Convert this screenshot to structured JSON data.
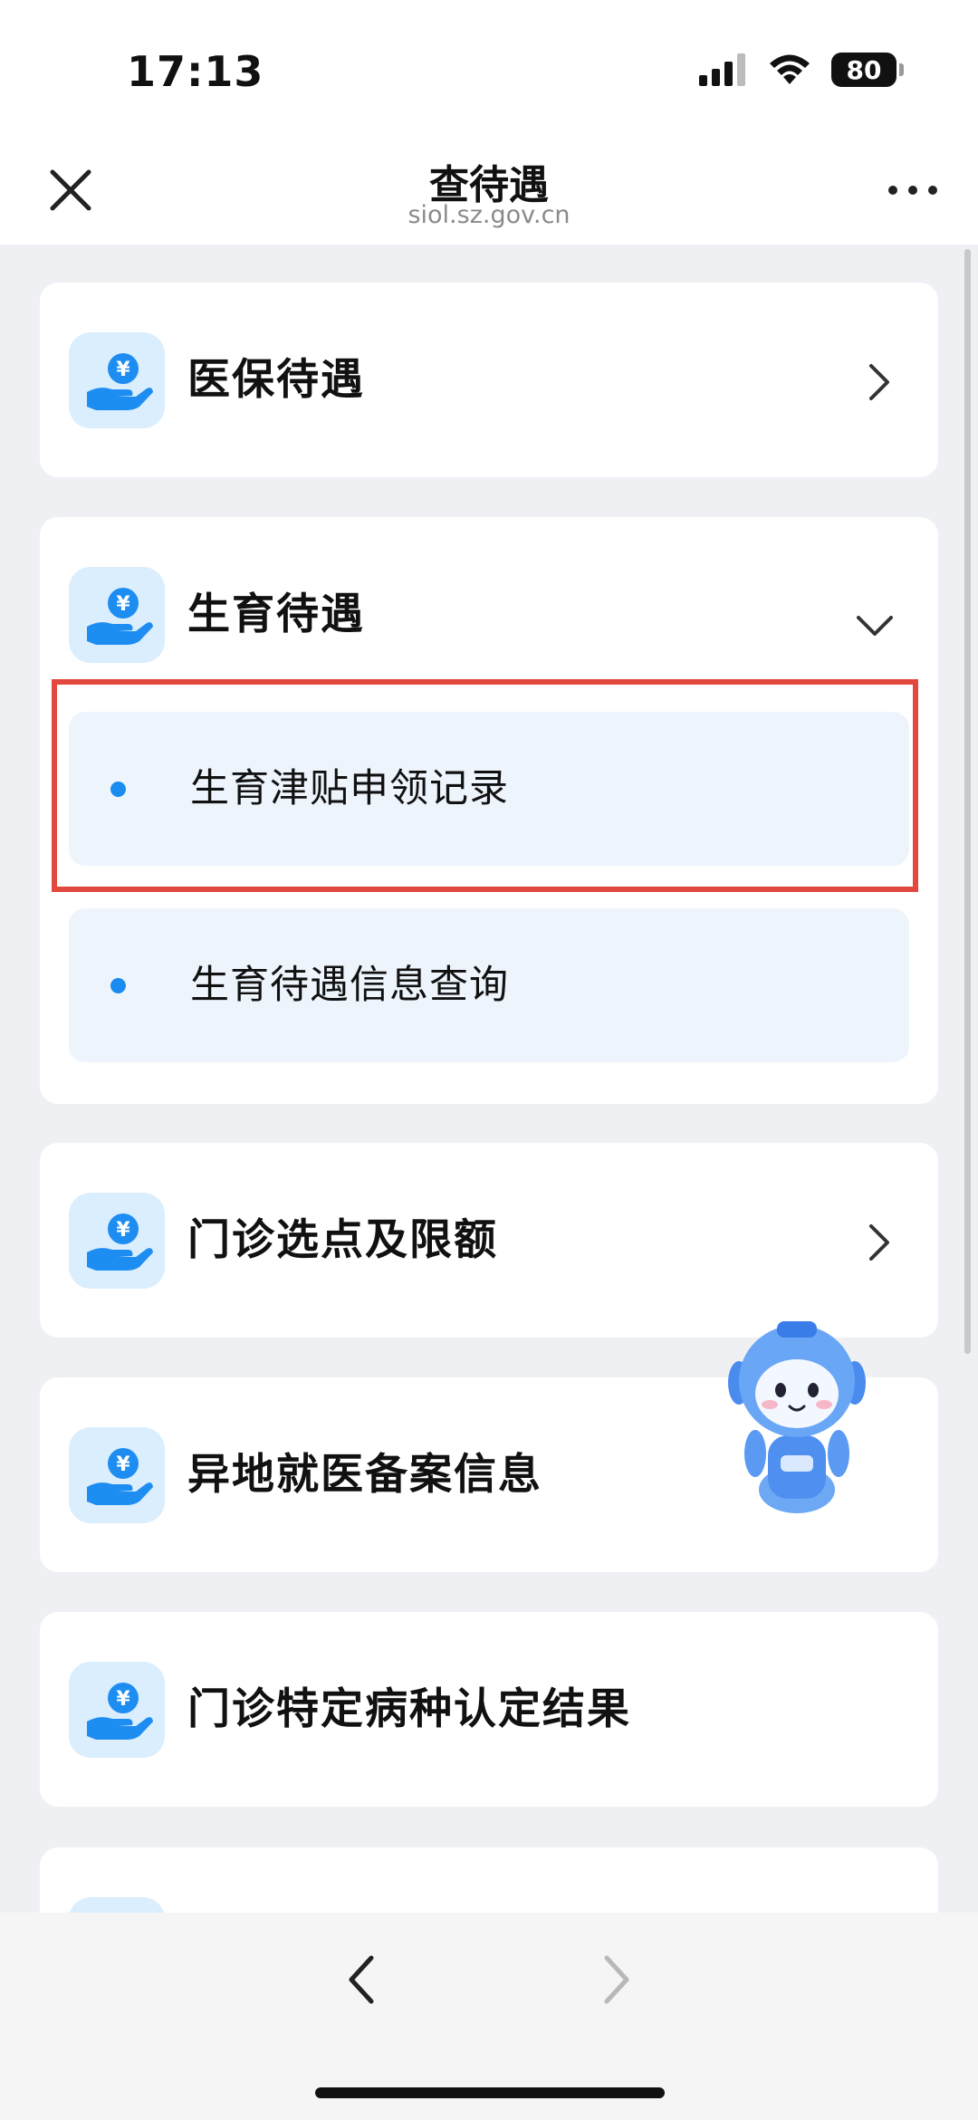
{
  "status_bar": {
    "time": "17:13",
    "battery": "80"
  },
  "header": {
    "title": "查待遇",
    "subtitle": "siol.sz.gov.cn"
  },
  "categories": [
    {
      "label": "医保待遇",
      "icon": "hand-yen-icon",
      "state": "collapsed"
    },
    {
      "label": "生育待遇",
      "icon": "hand-yen-icon",
      "state": "expanded",
      "sub_items": [
        {
          "label": "生育津贴申领记录",
          "highlighted": true
        },
        {
          "label": "生育待遇信息查询",
          "highlighted": false
        }
      ]
    },
    {
      "label": "门诊选点及限额",
      "icon": "hand-yen-icon",
      "state": "collapsed"
    },
    {
      "label": "异地就医备案信息",
      "icon": "hand-yen-icon"
    },
    {
      "label": "门诊特定病种认定结果",
      "icon": "hand-yen-icon"
    }
  ],
  "colors": {
    "accent": "#1a8cf0",
    "highlight_border": "#e2483d",
    "page_background": "#eef0f4",
    "sub_item_background": "#eef4fc",
    "icon_background": "#dbeefd"
  }
}
